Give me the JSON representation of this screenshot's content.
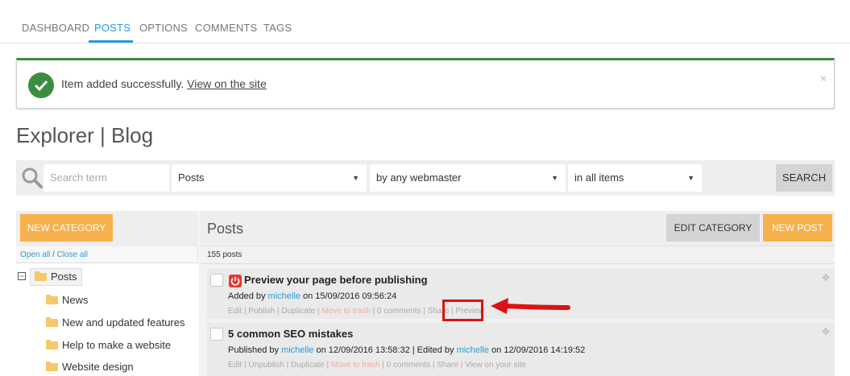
{
  "tabs": [
    {
      "label": "DASHBOARD",
      "active": false
    },
    {
      "label": "POSTS",
      "active": true
    },
    {
      "label": "OPTIONS",
      "active": false
    },
    {
      "label": "COMMENTS",
      "active": false
    },
    {
      "label": "TAGS",
      "active": false
    }
  ],
  "alert": {
    "message": "Item added successfully.",
    "link": "View on the site",
    "close": "×",
    "color": "#3c8d40"
  },
  "page_title": "Explorer | Blog",
  "search": {
    "placeholder": "Search term",
    "type_select": "Posts",
    "author_select": "by any webmaster",
    "scope_select": "in all items",
    "button": "SEARCH"
  },
  "left": {
    "new_category": "NEW CATEGORY",
    "open_all": "Open all",
    "separator": "/",
    "close_all": "Close all",
    "tree_toggle": "−",
    "root": "Posts",
    "children": [
      "News",
      "New and updated features",
      "Help to make a website",
      "Website design"
    ]
  },
  "right": {
    "title": "Posts",
    "edit_category": "EDIT CATEGORY",
    "new_post": "NEW POST",
    "count": "155 posts",
    "posts": [
      {
        "title": "Preview your page before publishing",
        "meta_prefix": "Added by",
        "user": "michelle",
        "meta_suffix": "on 15/09/2016 09:56:24",
        "actions": [
          "Edit",
          "Publish",
          "Duplicate",
          "Move to trash",
          "0 comments",
          "Share",
          "Preview"
        ]
      },
      {
        "title": "5 common SEO mistakes",
        "meta_prefix": "Published by",
        "user": "michelle",
        "meta_mid": "on 12/09/2016 13:58:32 | Edited by",
        "user2": "michelle",
        "meta_suffix": "on 12/09/2016 14:19:52",
        "actions": [
          "Edit",
          "Unpublish",
          "Duplicate",
          "Move to trash",
          "0 comments",
          "Share",
          "View on your site"
        ]
      }
    ]
  },
  "colors": {
    "accent": "#2b9bd6",
    "orange": "#f6b04c",
    "annotation": "#dd1111"
  }
}
